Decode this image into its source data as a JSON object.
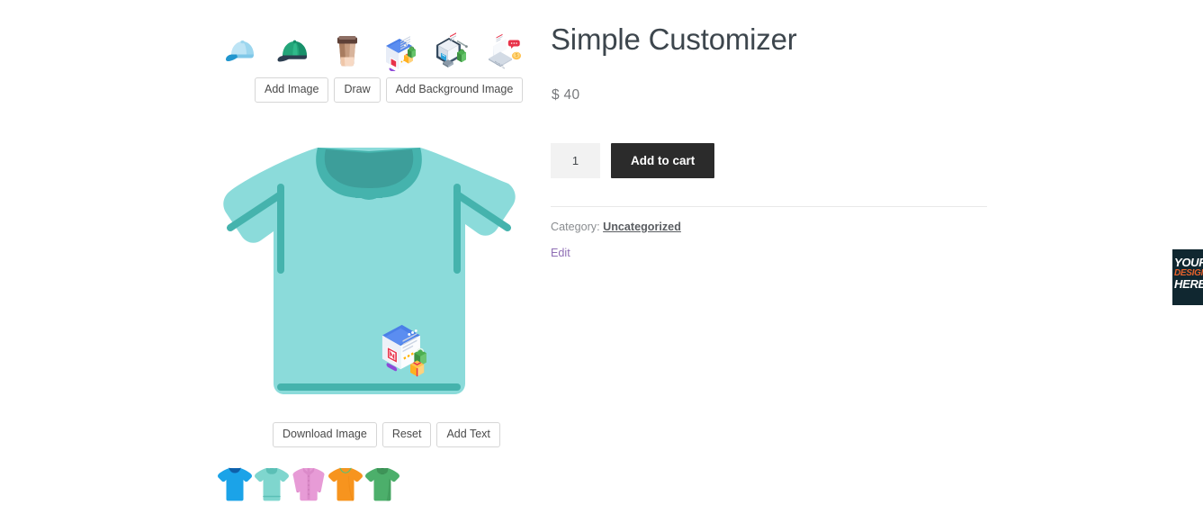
{
  "page": {
    "background": "#ffffff"
  },
  "customizer": {
    "clipart": [
      {
        "name": "light-blue-cap-icon",
        "label": "Light Blue Cap"
      },
      {
        "name": "green-cap-icon",
        "label": "Green Cap"
      },
      {
        "name": "coffee-cup-icon",
        "label": "Coffee Cup"
      },
      {
        "name": "ecommerce-website-icon",
        "label": "Ecommerce Website"
      },
      {
        "name": "online-store-monitor-icon",
        "label": "Online Store Monitor"
      },
      {
        "name": "laptop-payment-icon",
        "label": "Laptop Payment"
      }
    ],
    "top_tools": [
      {
        "name": "add-image-button",
        "label": "Add Image"
      },
      {
        "name": "draw-button",
        "label": "Draw"
      },
      {
        "name": "add-background-image-button",
        "label": "Add Background Image"
      }
    ],
    "bottom_tools": [
      {
        "name": "download-image-button",
        "label": "Download Image"
      },
      {
        "name": "reset-button",
        "label": "Reset"
      },
      {
        "name": "add-text-button",
        "label": "Add Text"
      }
    ],
    "canvas": {
      "garment": "polo-shirt",
      "body_color": "#8BDBDA",
      "accent_color": "#45B3AD",
      "placed_design": "ecommerce-website-icon"
    },
    "swatches": [
      {
        "name": "swatch-blue-tee",
        "label": "Blue T-Shirt",
        "color": "#1BA3E8",
        "style": "tee"
      },
      {
        "name": "swatch-teal-polo",
        "label": "Teal Polo",
        "color": "#7FD6CE",
        "style": "polo"
      },
      {
        "name": "swatch-pink-shirt",
        "label": "Pink Dress Shirt",
        "color": "#E79BD6",
        "style": "dress"
      },
      {
        "name": "swatch-orange-tee",
        "label": "Orange T-Shirt",
        "color": "#F7941E",
        "style": "tee-ringer"
      },
      {
        "name": "swatch-green-polo",
        "label": "Green Polo",
        "color": "#4CAF6B",
        "style": "polo"
      }
    ]
  },
  "product": {
    "title": "Simple Customizer",
    "price": "$ 40",
    "quantity_value": "1",
    "quantity_placeholder": "1",
    "add_to_cart_label": "Add to cart",
    "category_label": "Category:",
    "category_value": "Uncategorized",
    "edit_label": "Edit"
  },
  "side_widget": {
    "line1": "YOUR",
    "line2": "DESIGN",
    "line3": "HERE",
    "background": "#102730",
    "accent": "#e8622b"
  }
}
